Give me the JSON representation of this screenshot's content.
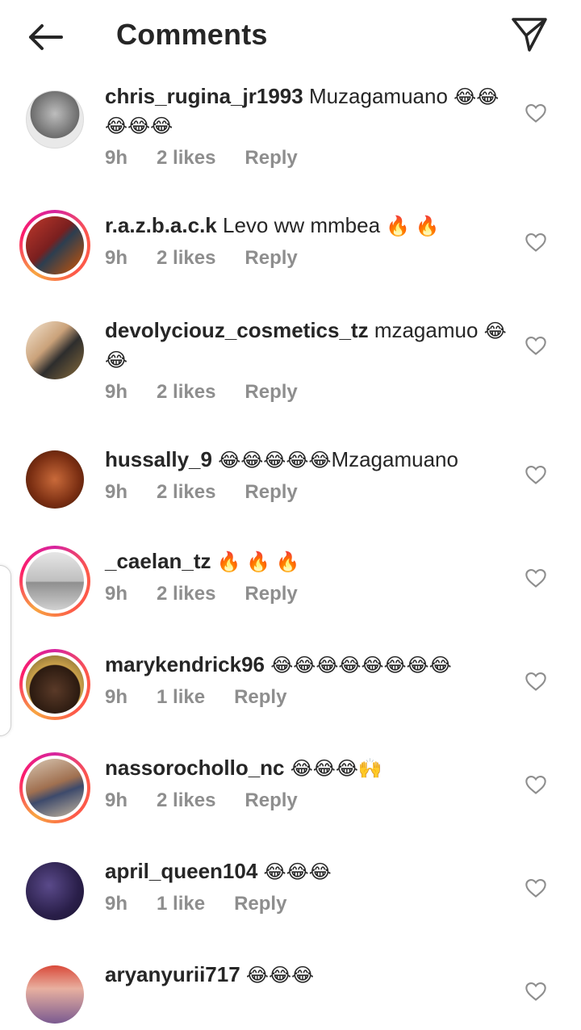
{
  "header": {
    "title": "Comments",
    "back_icon": "arrow-left-icon",
    "send_icon": "paper-plane-icon"
  },
  "comments": [
    {
      "username": "chris_rugina_jr1993",
      "text": "Muzagamuano",
      "emoji": "😂😂😂😂😂",
      "time": "9h",
      "likes": "2 likes",
      "reply": "Reply",
      "story_ring": false
    },
    {
      "username": "r.a.z.b.a.c.k",
      "text": "Levo ww mmbea",
      "emoji": "🔥 🔥",
      "time": "9h",
      "likes": "2 likes",
      "reply": "Reply",
      "story_ring": true
    },
    {
      "username": "devolyciouz_cosmetics_tz",
      "text": "mzagamuo",
      "emoji": "😂😂",
      "time": "9h",
      "likes": "2 likes",
      "reply": "Reply",
      "story_ring": false
    },
    {
      "username": "hussally_9",
      "text": "Mzagamuano",
      "emoji": "😂😂😂😂😂",
      "time": "9h",
      "likes": "2 likes",
      "reply": "Reply",
      "story_ring": false
    },
    {
      "username": "_caelan_tz",
      "text": "",
      "emoji": "🔥 🔥 🔥",
      "time": "9h",
      "likes": "2 likes",
      "reply": "Reply",
      "story_ring": true
    },
    {
      "username": "marykendrick96",
      "text": "",
      "emoji": "😂😂😂😂😂😂😂😂",
      "time": "9h",
      "likes": "1 like",
      "reply": "Reply",
      "story_ring": true
    },
    {
      "username": "nassorochollo_nc",
      "text": "",
      "emoji": "😂😂😂🙌",
      "time": "9h",
      "likes": "2 likes",
      "reply": "Reply",
      "story_ring": true
    },
    {
      "username": "april_queen104",
      "text": "",
      "emoji": "😂😂😂",
      "time": "9h",
      "likes": "1 like",
      "reply": "Reply",
      "story_ring": false
    },
    {
      "username": "aryanyurii717",
      "text": "",
      "emoji": "😂😂😂",
      "time": "",
      "likes": "",
      "reply": "",
      "story_ring": false
    }
  ],
  "icons": {
    "like": "heart-outline-icon"
  },
  "colors": {
    "text": "#262626",
    "meta": "#8e8e8e",
    "ring_start": "#d6249f",
    "ring_end": "#f7a441"
  }
}
